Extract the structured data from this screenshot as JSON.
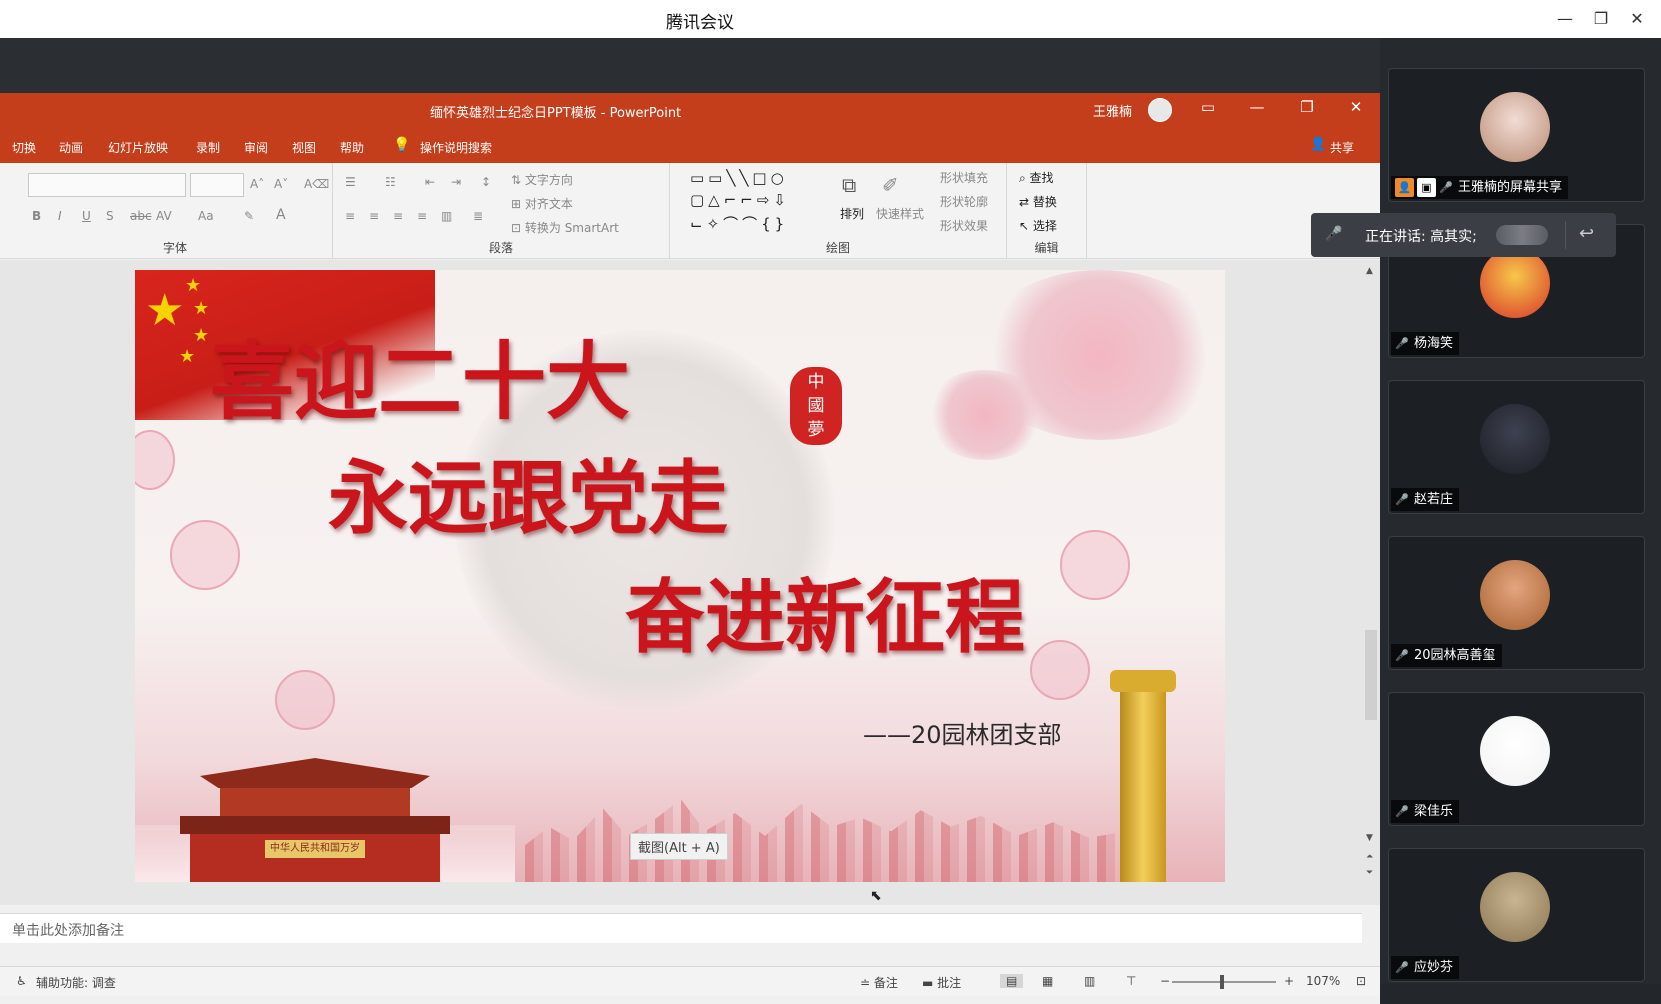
{
  "app": {
    "title": "腾讯会议"
  },
  "window_controls": {
    "minimize": "—",
    "restore": "❐",
    "close": "✕"
  },
  "powerpoint": {
    "doc_title": "缅怀英雄烈士纪念日PPT模板  -  PowerPoint",
    "user_name": "王雅楠",
    "menu": {
      "items": [
        "切换",
        "动画",
        "幻灯片放映",
        "录制",
        "审阅",
        "视图",
        "帮助"
      ],
      "search": "操作说明搜索",
      "share": "共享"
    },
    "ribbon": {
      "groups": {
        "font": "字体",
        "paragraph": "段落",
        "drawing": "绘图",
        "editing": "编辑"
      },
      "font_buttons": [
        "B",
        "I",
        "U",
        "S",
        "abc",
        "AV",
        "Aa"
      ],
      "paragraph_labels": {
        "text_dir": "文字方向",
        "align_text": "对齐文本",
        "smartart": "转换为 SmartArt"
      },
      "drawing_labels": {
        "arrange": "排列",
        "quick_styles": "快速样式",
        "fill": "形状填充",
        "outline": "形状轮廓",
        "effects": "形状效果"
      },
      "editing_labels": {
        "find": "查找",
        "replace": "替换",
        "select": "选择"
      }
    },
    "slide": {
      "line1": "喜迎二十大",
      "line2": "永远跟党走",
      "line3": "奋进新征程",
      "seal": [
        "中",
        "國",
        "夢"
      ],
      "gate_plaque": "中华人民共和国万岁",
      "subtitle": "——20园林团支部"
    },
    "screenshot_tooltip": "截图(Alt + A)",
    "notes_placeholder": "单击此处添加备注",
    "status": {
      "accessibility": "辅助功能: 调查",
      "notes": "备注",
      "comments": "批注",
      "zoom_minus": "−",
      "zoom_plus": "+",
      "zoom": "107%"
    }
  },
  "speaking": {
    "label": "正在讲话: 高其实;"
  },
  "participants": [
    {
      "name": "王雅楠的屏幕共享",
      "sharing": true,
      "colors": [
        "#f2dcd4",
        "#b98b74"
      ]
    },
    {
      "name": "杨海笑",
      "sharing": false,
      "colors": [
        "#f6c84a",
        "#d9352b"
      ]
    },
    {
      "name": "赵若庄",
      "sharing": false,
      "colors": [
        "#3e4250",
        "#1b1d24"
      ]
    },
    {
      "name": "20园林高善玺",
      "sharing": false,
      "colors": [
        "#e4a57f",
        "#a5602e"
      ]
    },
    {
      "name": "梁佳乐",
      "sharing": false,
      "colors": [
        "#ffffff",
        "#f2f2f2"
      ]
    },
    {
      "name": "应妙芬",
      "sharing": false,
      "colors": [
        "#c9b592",
        "#8b7553"
      ]
    }
  ]
}
